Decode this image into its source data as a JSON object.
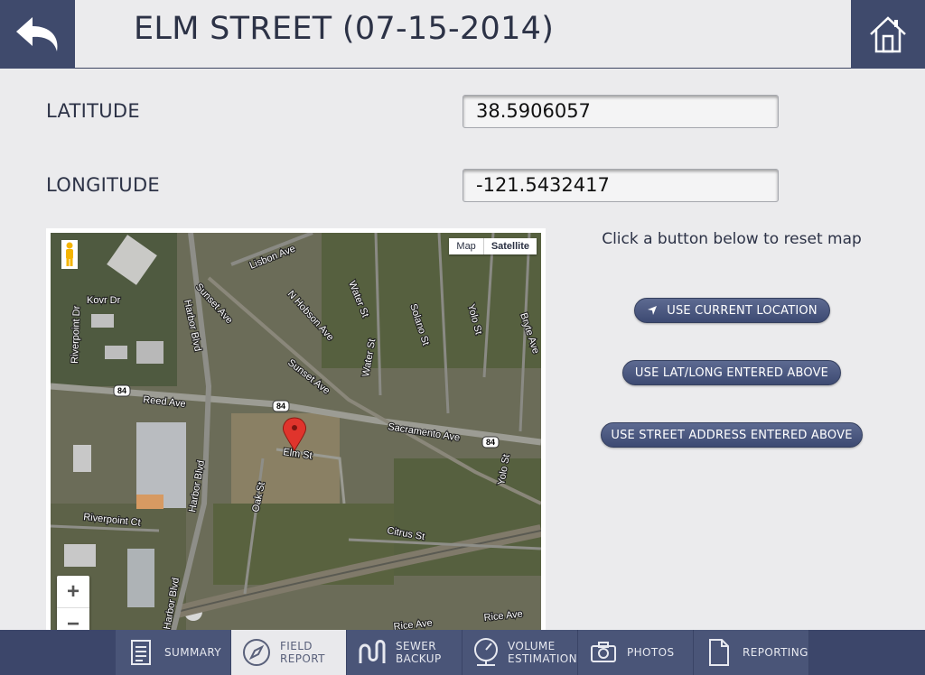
{
  "header": {
    "title": "ELM STREET (07-15-2014)"
  },
  "fields": {
    "latitude_label": "LATITUDE",
    "latitude_value": "38.5906057",
    "longitude_label": "LONGITUDE",
    "longitude_value": "-121.5432417"
  },
  "map": {
    "type_map": "Map",
    "type_satellite": "Satellite",
    "zoom_in": "+",
    "zoom_out": "−",
    "streets": {
      "lisbon": "Lisbon Ave",
      "sunset1": "Sunset Ave",
      "sunset2": "Sunset Ave",
      "hobson": "N Hobson Ave",
      "water1": "Water St",
      "water2": "Water St",
      "solano": "Solano St",
      "yolo1": "Yolo St",
      "yolo2": "Yolo St",
      "bryte": "Bryte Ave",
      "kovr": "Kovr Dr",
      "riverpointdr": "Riverpoint Dr",
      "harbor1": "Harbor Blvd",
      "harbor2": "Harbor Blvd",
      "harbor3": "Harbor Blvd",
      "reed": "Reed Ave",
      "sacramento": "Sacramento Ave",
      "elm": "Elm St",
      "oak": "Oak St",
      "riverpointct": "Riverpoint Ct",
      "citrus": "Citrus St",
      "rice1": "Rice Ave",
      "rice2": "Rice Ave",
      "hwy1": "84",
      "hwy2": "84",
      "hwy3": "84"
    }
  },
  "panel": {
    "hint": "Click a button below to reset map",
    "btn_current": "USE CURRENT LOCATION",
    "btn_latlong": "USE LAT/LONG ENTERED ABOVE",
    "btn_address": "USE STREET ADDRESS ENTERED ABOVE"
  },
  "nav": {
    "summary": "SUMMARY",
    "field_report_1": "FIELD",
    "field_report_2": "REPORT",
    "sewer_1": "SEWER",
    "sewer_2": "BACKUP",
    "volume_1": "VOLUME",
    "volume_2": "ESTIMATION",
    "photos": "PHOTOS",
    "reporting": "REPORTING"
  }
}
